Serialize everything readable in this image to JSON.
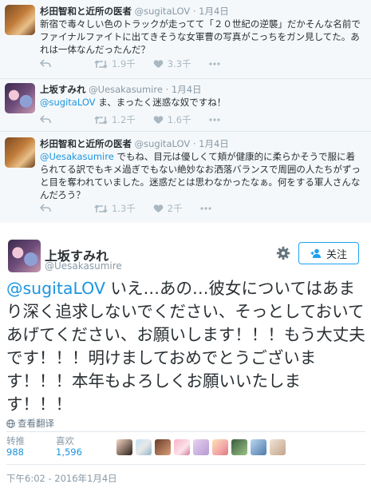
{
  "thread": [
    {
      "name": "杉田智和と近所の医者",
      "handle": "@sugitaLOV",
      "time": "1月4日",
      "mention": "",
      "text": "新宿で毒々しい色のトラックが走ってて「２０世紀の逆襲」だかそんな名前でファイナルファイトに出てきそうな女軍曹の写真がこっちをガン見してた。あれは一体なんだったんだ？",
      "retweets": "1.9千",
      "likes": "3.3千"
    },
    {
      "name": "上坂すみれ",
      "handle": "@Uesakasumire",
      "time": "1月4日",
      "mention": "@sugitaLOV",
      "text": " ま、まったく迷惑な奴ですね！",
      "retweets": "1.2千",
      "likes": "1.6千"
    },
    {
      "name": "杉田智和と近所の医者",
      "handle": "@sugitaLOV",
      "time": "1月4日",
      "mention": "@Uesakasumire",
      "text": " でもね、目元は優しくて頬が健康的に柔らかそうで服に着られてる訳でもキメ過ぎでもない絶妙なお洒落バランスで周囲の人たちがずっと目を奪われていました。迷惑だとは思わなかったなぁ。何をする軍人さんなんだろう？",
      "retweets": "1.3千",
      "likes": "2千"
    }
  ],
  "main": {
    "name": "上坂すみれ",
    "handle": "@Uesakasumire",
    "follow_label": "关注",
    "mention": "@sugitaLOV",
    "text": " いえ…あの…彼女についてはあまり深く追求しないでください、そっとしておいてあげてください、お願いします！！！もう大丈夫です！！！明けましておめでとうございます！！！本年もよろしくお願いいたします！！！",
    "translate_label": "查看翻译",
    "retweet_label": "转推",
    "retweet_count": "988",
    "like_label": "喜欢",
    "like_count": "1,596",
    "timestamp": "下午6:02 - 2016年1月4日"
  },
  "colors": {
    "link": "#1b95e0",
    "muted": "#8899a6",
    "border": "#e1e8ed",
    "thread_bg": "#f5f8fa",
    "follow_border": "#1da1f2"
  },
  "icons": [
    "reply-icon",
    "retweet-icon",
    "like-icon",
    "more-icon",
    "gear-icon",
    "follow-person-icon",
    "globe-icon"
  ]
}
